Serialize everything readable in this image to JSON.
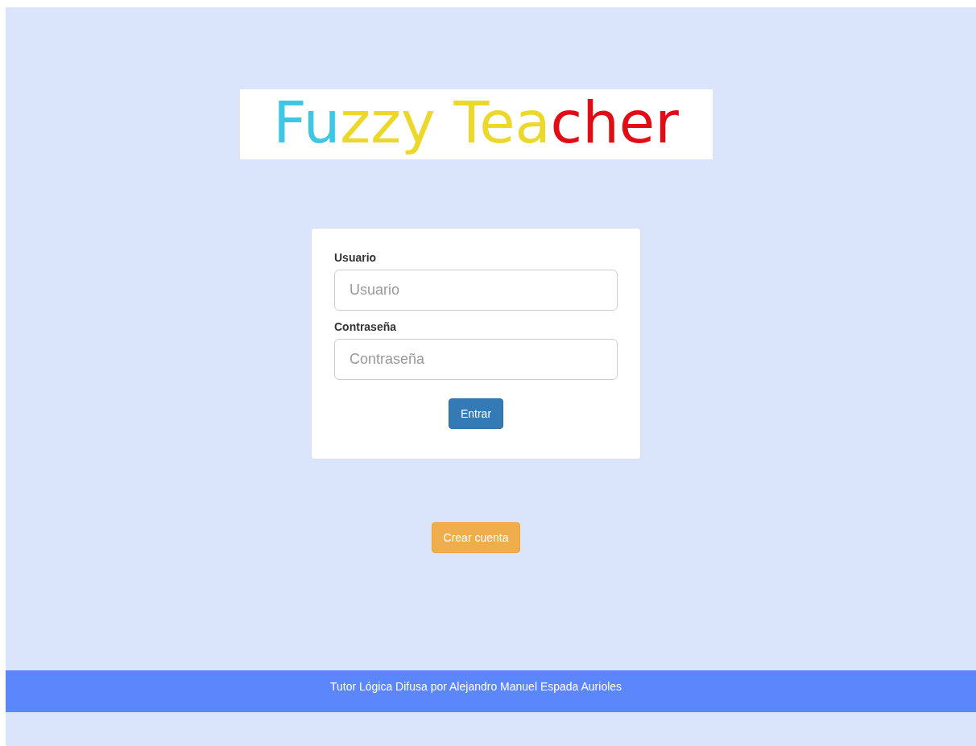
{
  "logo": [
    {
      "text": "Fu",
      "color": "#3ec6e6"
    },
    {
      "text": "zzy Tea",
      "color": "#ecd82a"
    },
    {
      "text": "cher",
      "color": "#e00c16"
    }
  ],
  "login_form": {
    "fields": [
      {
        "label": "Usuario",
        "placeholder": "Usuario"
      },
      {
        "label": "Contraseña",
        "placeholder": "Contraseña"
      }
    ],
    "submit_button": "Entrar"
  },
  "create_account_button": "Crear cuenta",
  "footer": "Tutor Lógica Difusa por Alejandro Manuel Espada Aurioles"
}
